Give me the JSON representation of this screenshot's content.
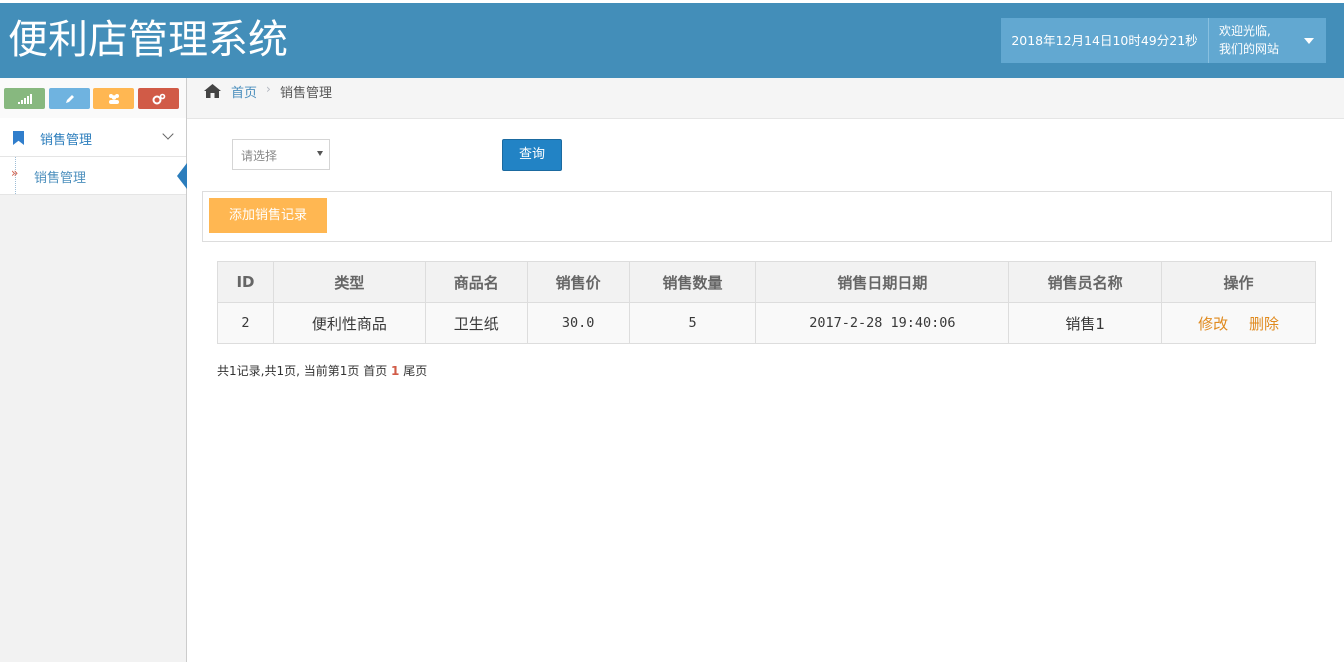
{
  "app": {
    "title": "便利店管理系统",
    "datetime": "2018年12月14日10时49分21秒",
    "welcome_line1": "欢迎光临,",
    "welcome_line2": "我们的网站"
  },
  "sidebar": {
    "shortcut_icons": [
      "signal-icon",
      "pencil-icon",
      "users-icon",
      "cogs-icon"
    ],
    "menu_label": "销售管理",
    "sub_label": "销售管理"
  },
  "breadcrumb": {
    "home": "首页",
    "current": "销售管理"
  },
  "filter": {
    "select_value": "请选择",
    "query_label": "查询"
  },
  "toolbar": {
    "add_label": "添加销售记录"
  },
  "table": {
    "headers": [
      "ID",
      "类型",
      "商品名",
      "销售价",
      "销售数量",
      "销售日期日期",
      "销售员名称",
      "操作"
    ],
    "rows": [
      {
        "id": "2",
        "type": "便利性商品",
        "name": "卫生纸",
        "price": "30.0",
        "qty": "5",
        "date": "2017-2-28 19:40:06",
        "seller": "销售1",
        "edit": "修改",
        "del": "删除"
      }
    ]
  },
  "pager": {
    "summary": "共1记录,共1页, 当前第1页",
    "first": "首页",
    "current": "1",
    "last": "尾页"
  },
  "colors": {
    "navbar": "#438eb9",
    "query_button": "#2283c5",
    "add_button": "#ffb752",
    "link_orange": "#e08a1e"
  }
}
